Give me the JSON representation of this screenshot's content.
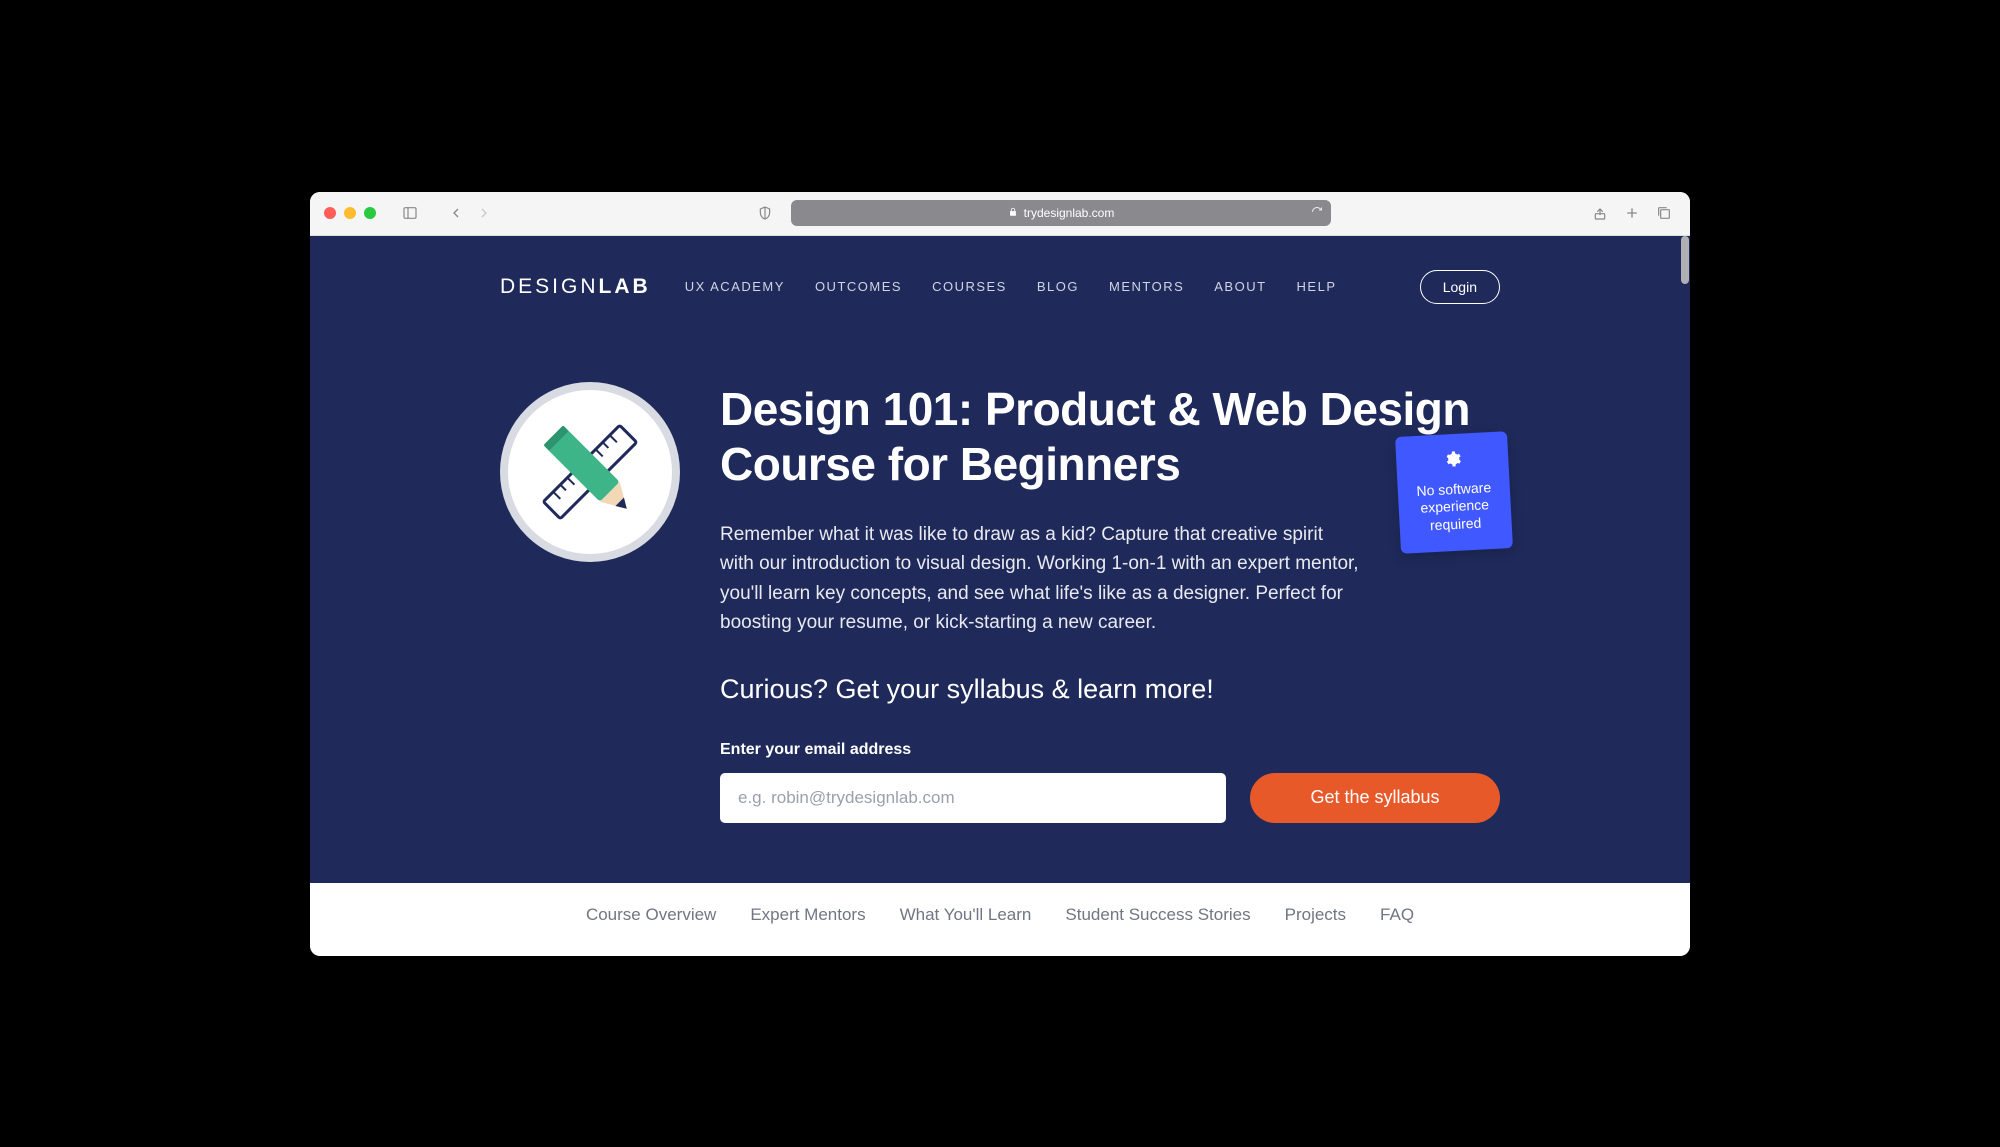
{
  "browser": {
    "url": "trydesignlab.com"
  },
  "logo": {
    "thin": "DESIGN",
    "bold": "LAB"
  },
  "nav": {
    "items": [
      "UX ACADEMY",
      "OUTCOMES",
      "COURSES",
      "BLOG",
      "MENTORS",
      "ABOUT",
      "HELP"
    ],
    "login": "Login"
  },
  "hero": {
    "title": "Design 101: Product & Web Design Course for Beginners",
    "description": "Remember what it was like to draw as a kid? Capture that creative spirit with our introduction to visual design. Working 1-on-1 with an expert mentor, you'll learn key concepts, and see what life's like as a designer. Perfect for boosting your resume, or kick-starting a new career.",
    "cta_heading": "Curious? Get your syllabus & learn more!",
    "email_label": "Enter your email address",
    "email_placeholder": "e.g. robin@trydesignlab.com",
    "button": "Get the syllabus",
    "callout": "No software experience required"
  },
  "subnav": {
    "items": [
      "Course Overview",
      "Expert Mentors",
      "What You'll Learn",
      "Student Success Stories",
      "Projects",
      "FAQ"
    ]
  }
}
